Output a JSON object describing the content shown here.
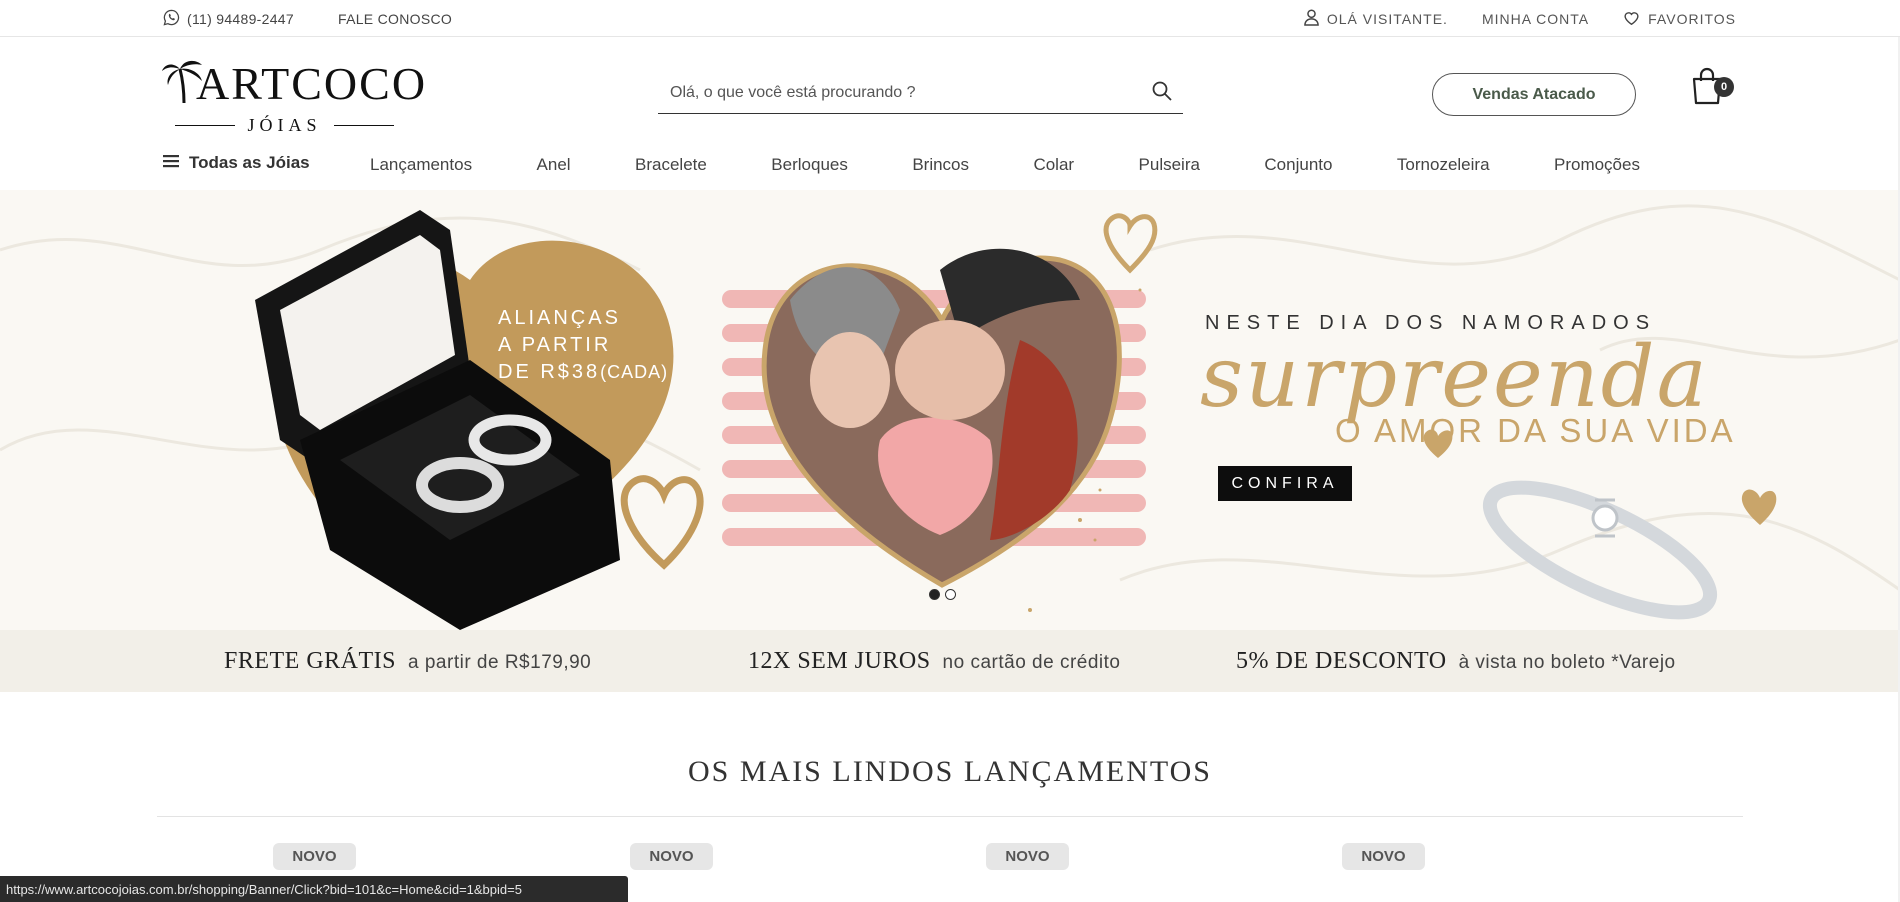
{
  "topbar": {
    "phone": "(11) 94489-2447",
    "contact": "FALE CONOSCO",
    "greeting": "OLÁ VISITANTE.",
    "account": "MINHA CONTA",
    "favorites": "FAVORITOS"
  },
  "logo": {
    "brand": "ARTCOCO",
    "sub": "JÓIAS"
  },
  "search": {
    "placeholder": "Olá, o que você está procurando ?"
  },
  "header": {
    "wholesale_label": "Vendas Atacado",
    "cart_count": "0"
  },
  "nav": {
    "all_label": "Todas as Jóias",
    "categories": [
      "Lançamentos",
      "Anel",
      "Bracelete",
      "Berloques",
      "Brincos",
      "Colar",
      "Pulseira",
      "Conjunto",
      "Tornozeleira",
      "Promoções"
    ]
  },
  "banner": {
    "promo_line1": "ALIANÇAS",
    "promo_line2": "A PARTIR",
    "promo_line3": "DE R$38",
    "promo_small": "(CADA)",
    "headline": "NESTE DIA DOS NAMORADOS",
    "script": "surpreenda",
    "subline": "O AMOR DA SUA VIDA",
    "cta": "CONFIRA",
    "slides": 2,
    "active_slide": 1
  },
  "benefits": [
    {
      "title": "FRETE GRÁTIS",
      "sub": "a partir de R$179,90"
    },
    {
      "title": "12X SEM JUROS",
      "sub": "no cartão de crédito"
    },
    {
      "title": "5% DE DESCONTO",
      "sub": "à vista no boleto *Varejo"
    }
  ],
  "section": {
    "title": "OS MAIS LINDOS LANÇAMENTOS",
    "badges": [
      "NOVO",
      "NOVO",
      "NOVO",
      "NOVO"
    ]
  },
  "statusbar": {
    "url": "https://www.artcocojoias.com.br/shopping/Banner/Click?bid=101&c=Home&cid=1&bpid=5"
  },
  "colors": {
    "gold": "#c9a56a",
    "banner_bg": "#faf8f3",
    "benefits_bg": "#f2efe8",
    "pink": "#f0b7b5"
  },
  "icons": [
    "whatsapp-icon",
    "user-icon",
    "heart-icon",
    "search-icon",
    "shopping-bag-icon",
    "menu-icon"
  ]
}
